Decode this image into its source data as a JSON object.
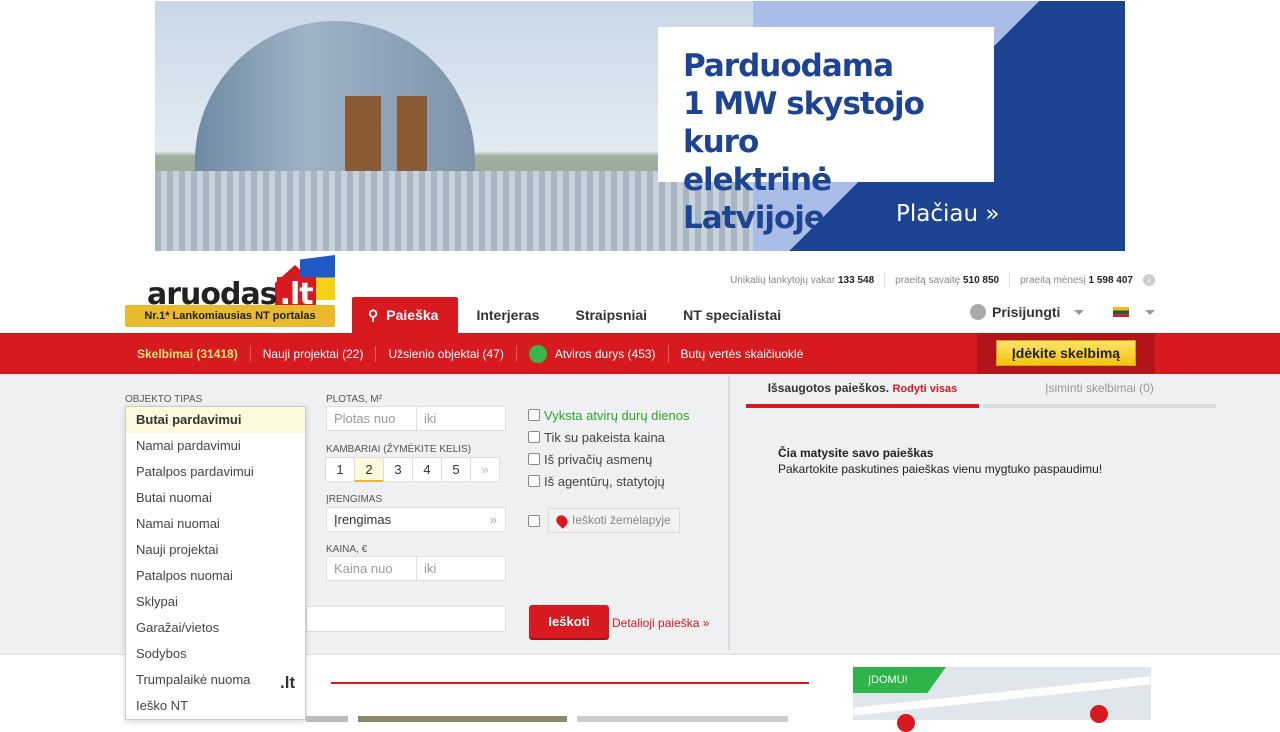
{
  "banner": {
    "headline": [
      "Parduodama",
      "1 MW skystojo kuro",
      "elektrinė Latvijoje"
    ],
    "more": "Plačiau »"
  },
  "logo": {
    "name_main": "aruodas",
    "name_tld": ".lt",
    "tagline": "Nr.1* Lankomiausias NT portalas"
  },
  "stats": {
    "yesterday_label": "Unikalių lankytojų vakar",
    "yesterday_value": "133 548",
    "week_label": "praeitą savaitę",
    "week_value": "510 850",
    "month_label": "praeitą mėnesį",
    "month_value": "1 598 407",
    "info": "i"
  },
  "nav": {
    "tabs": [
      "Paieška",
      "Interjeras",
      "Straipsniai",
      "NT specialistai"
    ],
    "login": "Prisijungti"
  },
  "redbar": {
    "items": [
      "Skelbimai (31418)",
      "Nauji projektai (22)",
      "Užsienio objektai (47)",
      "Atviros durys (453)",
      "Butų vertės skaičiuoklė"
    ],
    "post_button": "Įdėkite skelbimą"
  },
  "search": {
    "object_type_label": "OBJEKTO TIPAS",
    "area_label": "PLOTAS, m²",
    "area_from": "Plotas nuo",
    "area_to": "iki",
    "rooms_label": "KAMBARIAI (ŽYMĖKITE KELIS)",
    "rooms": [
      "1",
      "2",
      "3",
      "4",
      "5",
      "»"
    ],
    "equipment_label": "ĮRENGIMAS",
    "equipment_value": "Įrengimas",
    "equipment_arrow": "»",
    "price_label": "KAINA, €",
    "price_from": "Kaina nuo",
    "price_to": "iki",
    "checks": [
      "Vyksta atvirų durų dienos",
      "Tik su pakeista kaina",
      "Iš privačių asmenų",
      "Iš agentūrų, statytojų"
    ],
    "map_button": "Ieškoti žemėlapyje",
    "search_button": "Ieškoti",
    "detail_link": "Detalioji paieška »"
  },
  "saved": {
    "tab1": "Išsaugotos paieškos.",
    "tab1_link": "Rodyti visas",
    "tab2": "Įsiminti skelbimai (0)",
    "msg_title": "Čia matysite savo paieškas",
    "msg_text": "Pakartokite paskutines paieškas vienu mygtuko paspaudimu!"
  },
  "dropdown": {
    "options": [
      "Butai pardavimui",
      "Namai pardavimui",
      "Patalpos pardavimui",
      "Butai nuomai",
      "Namai nuomai",
      "Nauji projektai",
      "Patalpos nuomai",
      "Sklypai",
      "Garažai/vietos",
      "Sodybos",
      "Trumpalaikė nuoma",
      "Ieško NT"
    ],
    "selected": 0
  },
  "bottom": {
    "title_suffix": ".lt",
    "domu": "ĮDOMU!"
  }
}
